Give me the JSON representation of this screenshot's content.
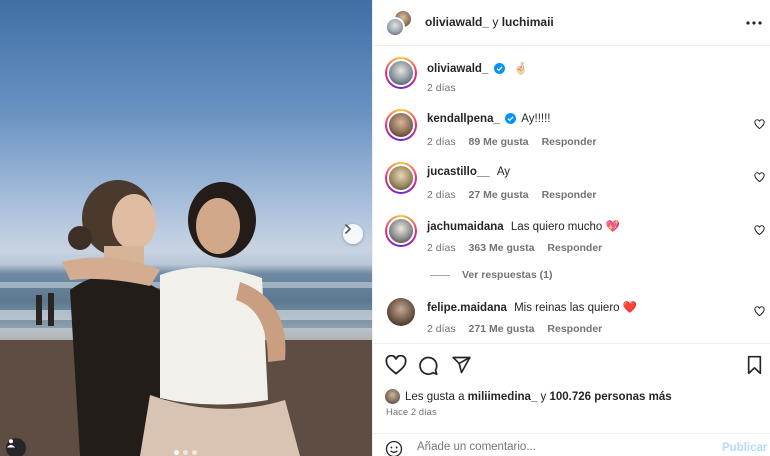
{
  "post": {
    "author": "oliviawald_",
    "coauthor_joiner": "y",
    "coauthor": "luchimaii"
  },
  "caption": {
    "user": "oliviawald_",
    "emoji": "🤞🏻",
    "time": "2 días"
  },
  "comments": [
    {
      "user": "kendallpena_",
      "verified": true,
      "text": "Ay!!!!!",
      "time": "2 días",
      "likes": "89 Me gusta",
      "reply": "Responder"
    },
    {
      "user": "jucastillo__",
      "verified": false,
      "text": "Ay",
      "time": "2 días",
      "likes": "27 Me gusta",
      "reply": "Responder"
    },
    {
      "user": "jachumaidana",
      "verified": false,
      "text": "Las quiero mucho 💖",
      "time": "2 días",
      "likes": "363 Me gusta",
      "reply": "Responder"
    },
    {
      "user": "felipe.maidana",
      "verified": false,
      "text": "Mis reinas las quiero ❤️",
      "time": "2 días",
      "likes": "271 Me gusta",
      "reply": "Responder"
    }
  ],
  "view_replies": "Ver respuestas (1)",
  "likes_summary": {
    "prefix": "Les gusta a",
    "user": "miliimedina_",
    "joiner": "y",
    "count": "100.726 personas más"
  },
  "posted_ago": "Hace 2 días",
  "composer": {
    "placeholder": "Añade un comentario...",
    "publish": "Publicar"
  },
  "colors": {
    "verified": "#0095f6",
    "publish_disabled": "#b3dbff",
    "muted": "#737373"
  },
  "icons": [
    "more-icon",
    "heart-icon",
    "comment-icon",
    "share-icon",
    "bookmark-icon",
    "emoji-icon",
    "chevron-right-icon",
    "user-tag-icon",
    "verified-icon"
  ]
}
